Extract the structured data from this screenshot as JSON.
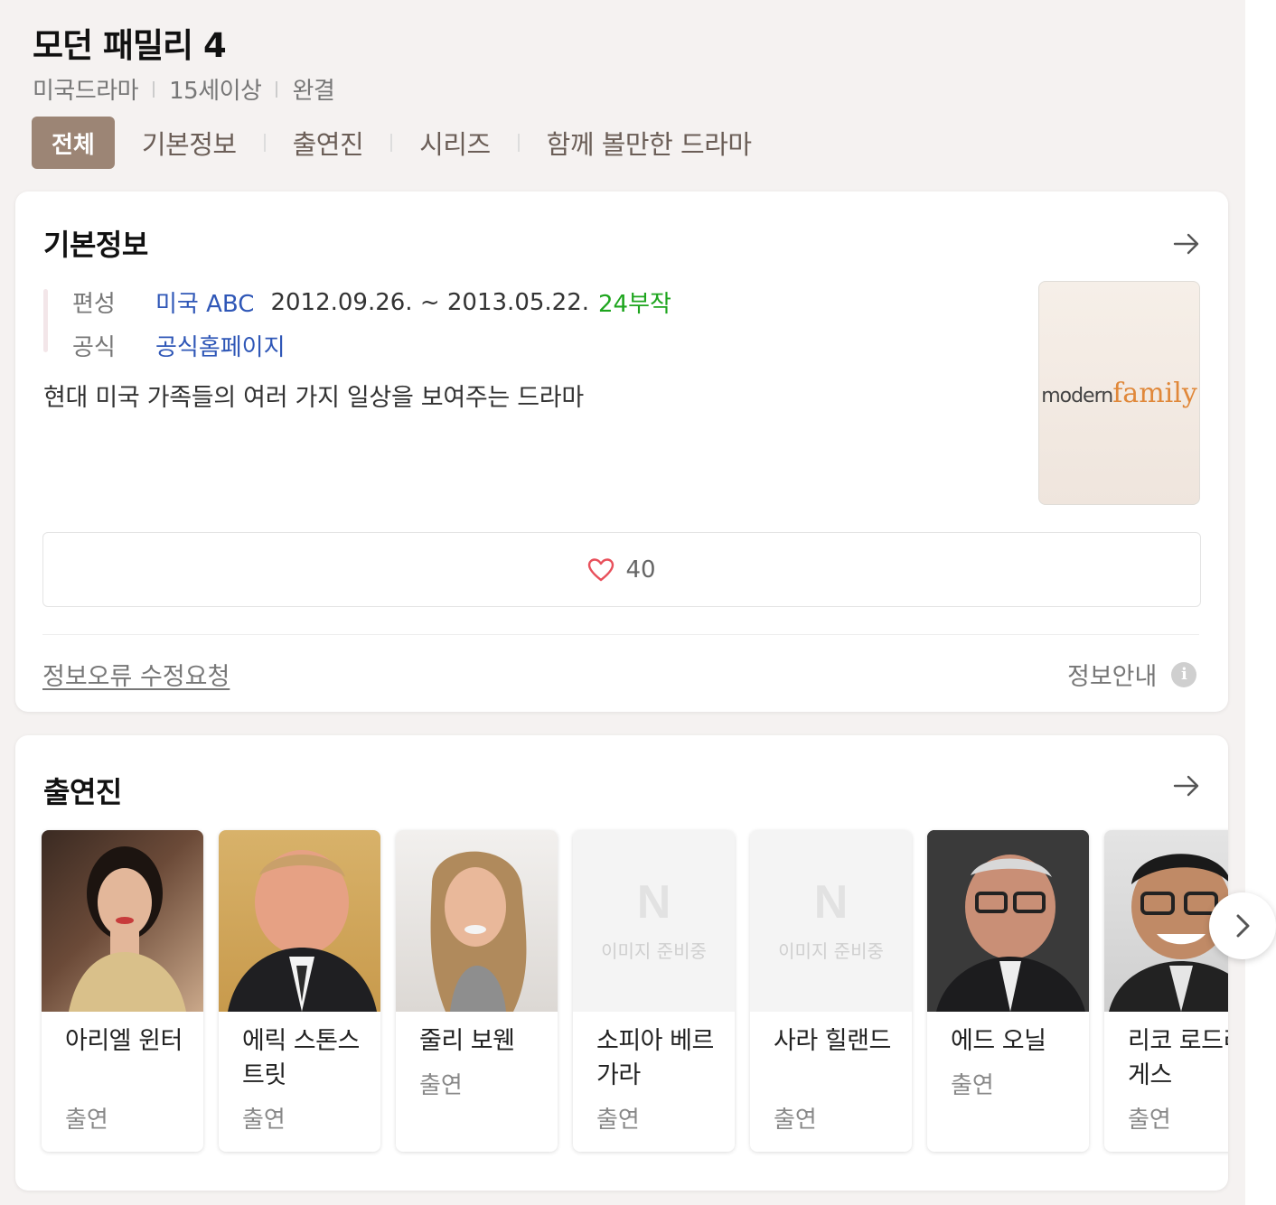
{
  "header": {
    "title": "모던 패밀리 4",
    "meta": [
      "미국드라마",
      "15세이상",
      "완결"
    ]
  },
  "tabs": {
    "active": "전체",
    "items": [
      "기본정보",
      "출연진",
      "시리즈",
      "함께 볼만한 드라마"
    ]
  },
  "basic_info": {
    "title": "기본정보",
    "broadcast_label": "편성",
    "broadcast_channel": "미국 ABC",
    "broadcast_period": "2012.09.26. ~ 2013.05.22.",
    "episodes": "24부작",
    "official_label": "공식",
    "official_link": "공식홈페이지",
    "description": "현대 미국 가족들의 여러 가지 일상을 보여주는 드라마",
    "poster_logo_modern": "modern",
    "poster_logo_family": "family",
    "like_count": "40",
    "report_link": "정보오류 수정요청",
    "guide_label": "정보안내"
  },
  "cast": {
    "title": "출연진",
    "placeholder_label": "이미지 준비중",
    "members": [
      {
        "name": "아리엘 윈터",
        "role": "출연"
      },
      {
        "name": "에릭 스톤스트릿",
        "role": "출연"
      },
      {
        "name": "줄리 보웬",
        "role": "출연"
      },
      {
        "name": "소피아 베르가라",
        "role": "출연"
      },
      {
        "name": "사라 힐랜드",
        "role": "출연"
      },
      {
        "name": "에드 오닐",
        "role": "출연"
      },
      {
        "name": "리코 로드리게스",
        "role": "출연"
      }
    ]
  },
  "colors": {
    "active_tab": "#9c8575",
    "link_blue": "#2f57b7",
    "episodes_green": "#1ea51e",
    "heart": "#e8505b"
  }
}
